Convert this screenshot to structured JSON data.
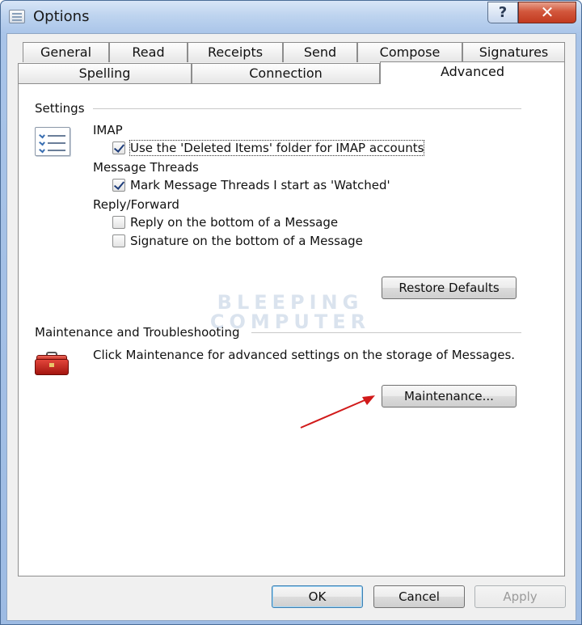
{
  "window": {
    "title": "Options",
    "help_glyph": "?",
    "close_glyph": "✕"
  },
  "tabs_row1": [
    "General",
    "Read",
    "Receipts",
    "Send",
    "Compose",
    "Signatures"
  ],
  "tabs_row2": [
    "Spelling",
    "Connection",
    "Advanced"
  ],
  "active_tab": "Advanced",
  "settings": {
    "group_label": "Settings",
    "imap_label": "IMAP",
    "imap_option": {
      "label": "Use the 'Deleted Items' folder for IMAP accounts",
      "checked": true
    },
    "threads_label": "Message Threads",
    "threads_option": {
      "label": "Mark Message Threads I start as 'Watched'",
      "checked": true
    },
    "reply_label": "Reply/Forward",
    "reply_bottom": {
      "label": "Reply on the bottom of a Message",
      "checked": false
    },
    "signature_bottom": {
      "label": "Signature on the bottom of a Message",
      "checked": false
    },
    "restore_button": "Restore Defaults"
  },
  "maintenance": {
    "group_label": "Maintenance and Troubleshooting",
    "description": "Click Maintenance for advanced settings on the storage of Messages.",
    "button": "Maintenance..."
  },
  "watermark": {
    "line1": "BLEEPING",
    "line2": "COMPUTER"
  },
  "footer": {
    "ok": "OK",
    "cancel": "Cancel",
    "apply": "Apply"
  },
  "colors": {
    "arrow": "#d11a1a",
    "titlebar": "#bed4ef",
    "close": "#c23a20"
  },
  "icons": {
    "settings": "checklist-icon",
    "maintenance": "toolbox-icon"
  }
}
